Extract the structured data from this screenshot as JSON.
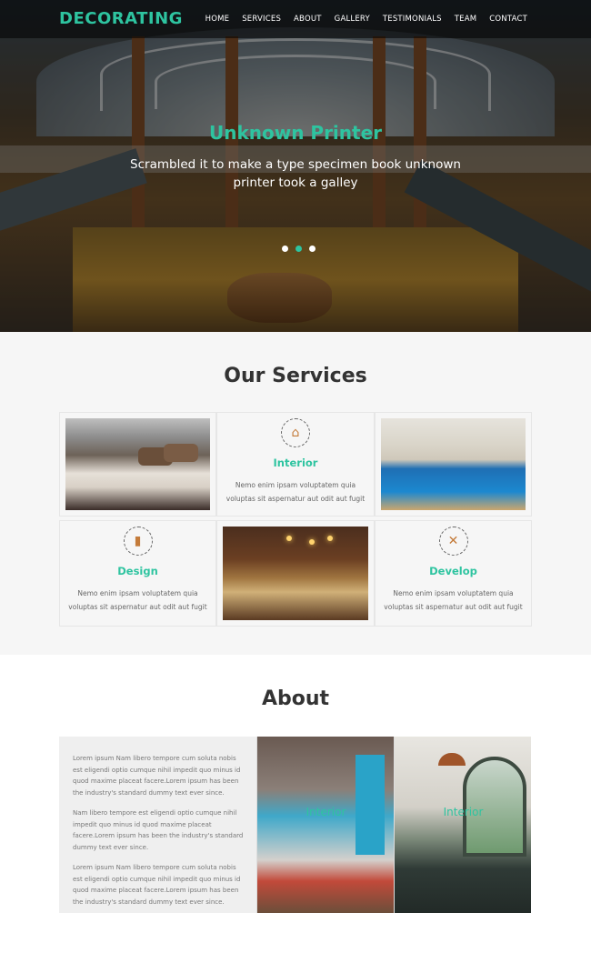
{
  "header": {
    "brand": "DECORATING",
    "nav": [
      "HOME",
      "SERVICES",
      "ABOUT",
      "GALLERY",
      "TESTIMONIALS",
      "TEAM",
      "CONTACT"
    ]
  },
  "hero": {
    "title": "Unknown Printer",
    "subtitle": "Scrambled it to make a type specimen book unknown printer took a galley",
    "slides": 3,
    "active_slide": 2
  },
  "services": {
    "title": "Our Services",
    "items": [
      {
        "name": "Interior",
        "icon": "couch-icon",
        "desc": "Nemo enim ipsam voluptatem quia voluptas sit aspernatur aut odit aut fugit"
      },
      {
        "name": "Design",
        "icon": "paint-roller-icon",
        "desc": "Nemo enim ipsam voluptatem quia voluptas sit aspernatur aut odit aut fugit"
      },
      {
        "name": "Develop",
        "icon": "tools-icon",
        "desc": "Nemo enim ipsam voluptatem quia voluptas sit aspernatur aut odit aut fugit"
      }
    ]
  },
  "about": {
    "title": "About",
    "paragraphs": [
      "Lorem ipsum Nam libero tempore cum soluta nobis est eligendi optio cumque nihil impedit quo minus id quod maxime placeat facere.Lorem ipsum has been the industry's standard dummy text ever since.",
      "Nam libero tempore est eligendi optio cumque nihil impedit quo minus id quod maxime placeat facere.Lorem ipsum has been the industry's standard dummy text ever since.",
      "Lorem ipsum Nam libero tempore cum soluta nobis est eligendi optio cumque nihil impedit quo minus id quod maxime placeat facere.Lorem ipsum has been the industry's standard dummy text ever since."
    ],
    "image_labels": [
      "Interior",
      "Interior"
    ]
  },
  "colors": {
    "accent": "#2ec4a0",
    "nav_bg": "#000000",
    "section_bg": "#f6f6f6"
  }
}
